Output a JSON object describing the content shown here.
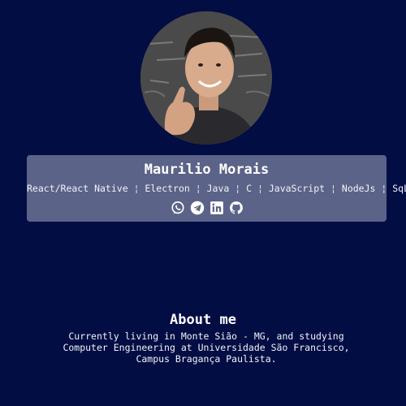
{
  "profile": {
    "name": "Maurilio Morais",
    "skills": [
      {
        "label": "React/React Native"
      },
      {
        "label": "Electron"
      },
      {
        "label": "Java"
      },
      {
        "label": "C"
      },
      {
        "label": "JavaScript"
      },
      {
        "label": "NodeJs"
      },
      {
        "label": "SqLite"
      }
    ],
    "separator": "¦",
    "social_icons": [
      "whatsapp-icon",
      "telegram-icon",
      "linkedin-icon",
      "github-icon"
    ]
  },
  "about": {
    "title": "About me",
    "text": "Currently living in Monte Sião - MG, and studying Computer Engineering at Universidade São Francisco, Campus Bragança Paulista."
  },
  "colors": {
    "background": "#020d44",
    "card": "#5b6388",
    "text": "#ffffff"
  }
}
